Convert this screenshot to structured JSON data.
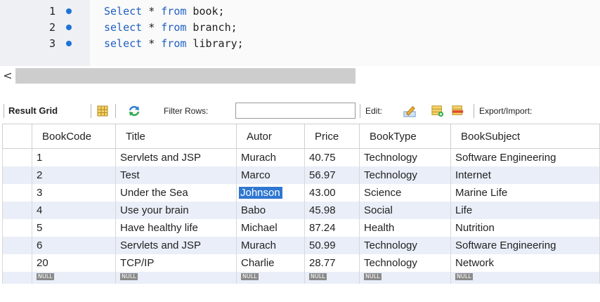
{
  "editor": {
    "lines": [
      {
        "num": "1",
        "kw1": "Select",
        "rest1": " * ",
        "kw2": "from",
        "rest2": " book;"
      },
      {
        "num": "2",
        "kw1": "select",
        "rest1": " * ",
        "kw2": "from",
        "rest2": " branch;"
      },
      {
        "num": "3",
        "kw1": "select",
        "rest1": " * ",
        "kw2": "from",
        "rest2": " library;"
      }
    ]
  },
  "scroll": {
    "left_arrow": "<"
  },
  "toolbar": {
    "result_grid": "Result Grid",
    "filter_rows": "Filter Rows:",
    "filter_value": "",
    "edit": "Edit:",
    "export_import": "Export/Import:"
  },
  "grid": {
    "columns": [
      "BookCode",
      "Title",
      "Autor",
      "Price",
      "BookType",
      "BookSubject"
    ],
    "rows": [
      [
        "1",
        "Servlets and JSP",
        "Murach",
        "40.75",
        "Technology",
        "Software Engineering"
      ],
      [
        "2",
        "Test",
        "Marco",
        "56.97",
        "Technology",
        "Internet"
      ],
      [
        "3",
        "Under the Sea",
        "Johnson",
        "43.00",
        "Science",
        "Marine Life"
      ],
      [
        "4",
        "Use your brain",
        "Babo",
        "45.98",
        "Social",
        "Life"
      ],
      [
        "5",
        "Have healthy life",
        "Michael",
        "87.24",
        "Health",
        "Nutrition"
      ],
      [
        "6",
        "Servlets and JSP",
        "Murach",
        "50.99",
        "Technology",
        "Software Engineering"
      ],
      [
        "20",
        "TCP/IP",
        "Charlie",
        "28.77",
        "Technology",
        "Network"
      ]
    ],
    "null_label": "NULL",
    "selected_cell": {
      "row": 2,
      "col": 2
    }
  },
  "colors": {
    "accent": "#2f77d1",
    "keyword": "#1f5fc2",
    "alt_row": "#e9eef8"
  }
}
